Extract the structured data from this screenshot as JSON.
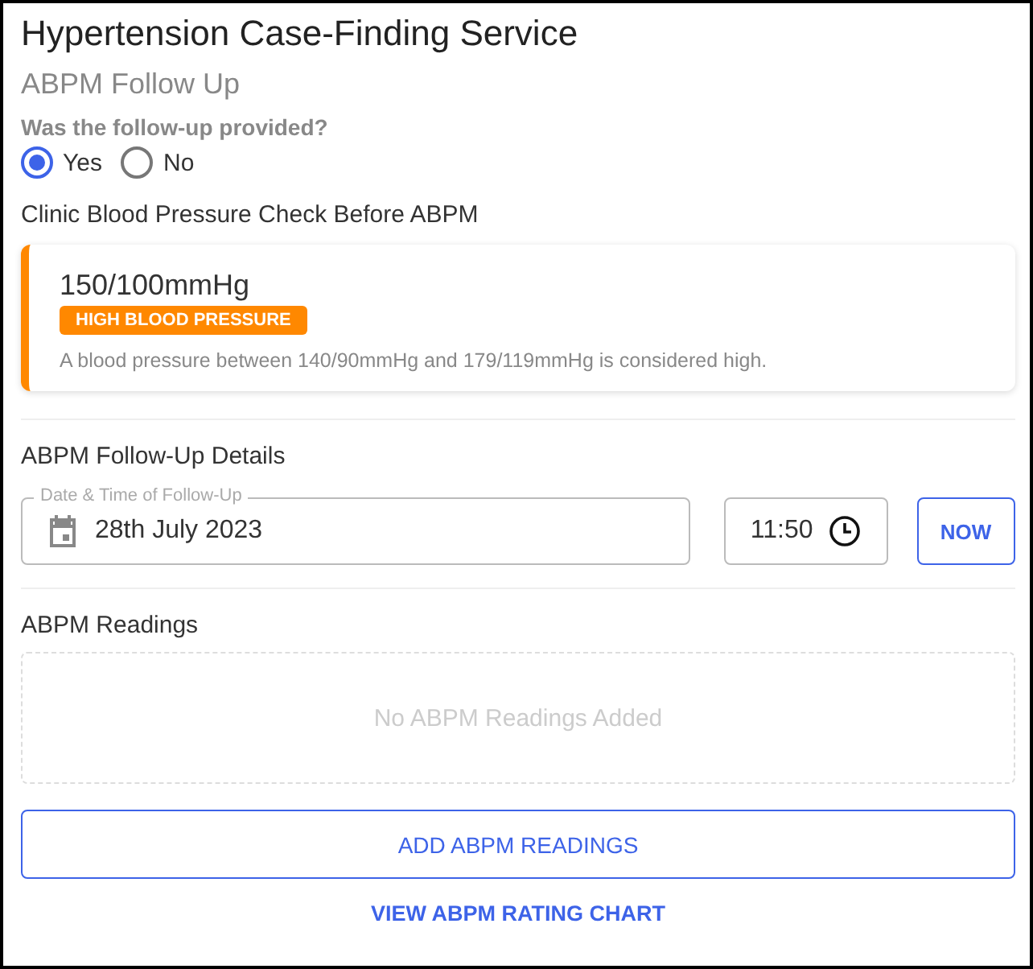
{
  "title": "Hypertension Case-Finding Service",
  "subtitle": "ABPM Follow Up",
  "question": {
    "label": "Was the follow-up provided?",
    "options": [
      {
        "label": "Yes",
        "selected": true
      },
      {
        "label": "No",
        "selected": false
      }
    ]
  },
  "clinic_check": {
    "heading": "Clinic Blood Pressure Check Before ABPM",
    "reading": "150/100mmHg",
    "badge": "HIGH BLOOD PRESSURE",
    "description": "A blood pressure between 140/90mmHg and 179/119mmHg is considered high."
  },
  "details": {
    "heading": "ABPM Follow-Up Details",
    "date_label": "Date & Time of Follow-Up",
    "date": "28th July 2023",
    "time": "11:50",
    "now_button": "NOW"
  },
  "readings": {
    "heading": "ABPM Readings",
    "empty": "No ABPM Readings Added",
    "add_button": "ADD ABPM READINGS",
    "chart_link": "VIEW ABPM RATING CHART"
  }
}
